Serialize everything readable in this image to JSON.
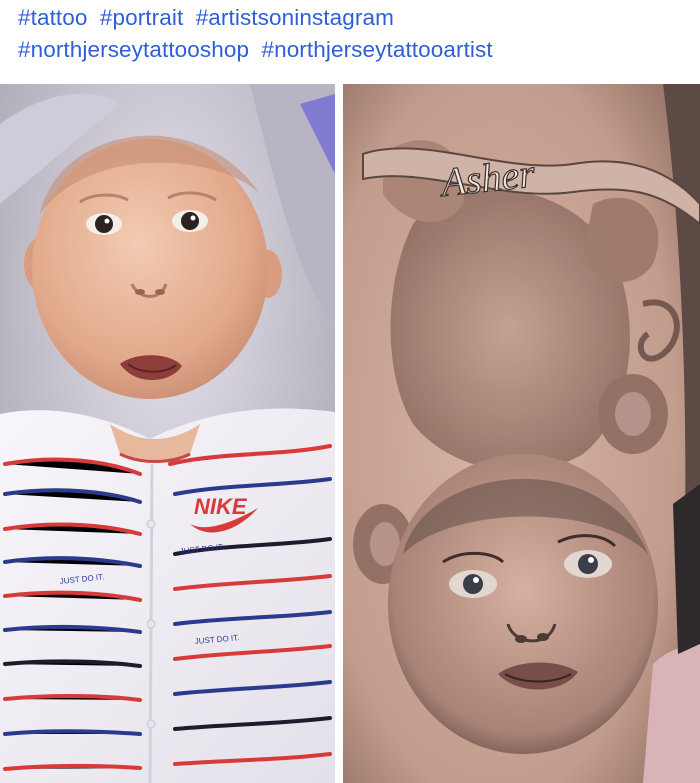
{
  "post": {
    "caption": {
      "line1": [
        "#tattoo",
        "#portrait",
        "#artistsoninstagram"
      ],
      "line2": [
        "#northjerseytattooshop",
        "#northjerseytattooartist"
      ]
    },
    "photos": {
      "left": {
        "shirt_logo": "NIKE",
        "shirt_print": "JUST DO IT."
      },
      "right": {
        "tattoo_name": "Asher"
      }
    }
  },
  "colors": {
    "hashtag": "#2f5fd6",
    "stripe_red": "#d83a3a",
    "stripe_navy": "#2a3a8c",
    "skin": "#e8b89c",
    "tattoo_skin": "#c9a493"
  }
}
